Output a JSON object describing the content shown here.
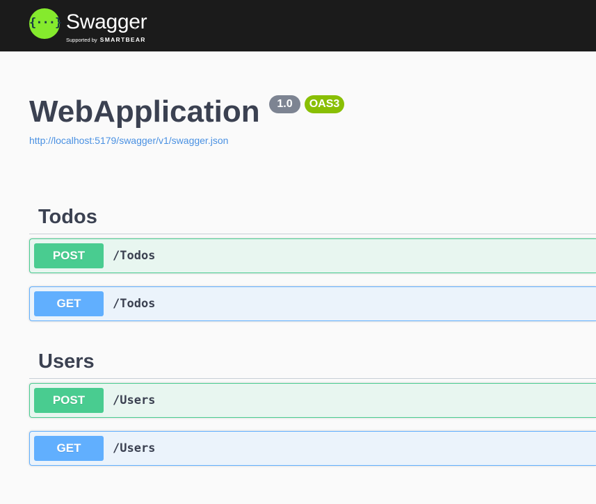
{
  "topbar": {
    "logo_glyph": "{···}",
    "brand_name": "Swagger",
    "brand_supported_by": "Supported by",
    "brand_company": "SMARTBEAR",
    "background_color": "#1b1b1b",
    "logo_color": "#85ea2d"
  },
  "info": {
    "title": "WebApplication",
    "version": "1.0",
    "oas": "OAS3",
    "spec_url": "http://localhost:5179/swagger/v1/swagger.json"
  },
  "tags": [
    {
      "name": "Todos",
      "operations": [
        {
          "method": "POST",
          "path": "/Todos"
        },
        {
          "method": "GET",
          "path": "/Todos"
        }
      ]
    },
    {
      "name": "Users",
      "operations": [
        {
          "method": "POST",
          "path": "/Users"
        },
        {
          "method": "GET",
          "path": "/Users"
        }
      ]
    }
  ],
  "colors": {
    "post": "#49cc90",
    "get": "#61affe",
    "title_text": "#3b4151",
    "link": "#4990e2",
    "version_badge": "#7d8492",
    "oas_badge": "#89bf04"
  }
}
